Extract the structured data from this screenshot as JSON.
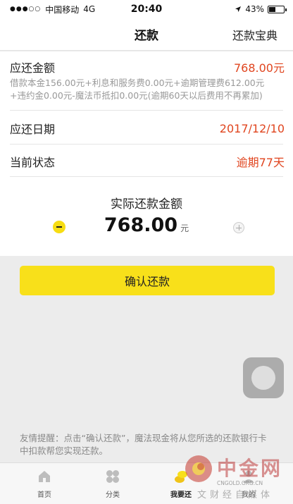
{
  "status_bar": {
    "signal": "●●●○○",
    "carrier": "中国移动",
    "network": "4G",
    "time": "20:40",
    "location_icon": "location-arrow-icon",
    "battery_percent_text": "43%",
    "battery_level": 0.43
  },
  "nav": {
    "title": "还款",
    "right_link": "还款宝典"
  },
  "repayment": {
    "amount_label": "应还金额",
    "amount_value": "768.00元",
    "detail": "借款本金156.00元+利息和服务费0.00元+逾期管理费612.00元+违约金0.00元-魔法币抵扣0.00元(逾期60天以后费用不再累加)",
    "due_date_label": "应还日期",
    "due_date_value": "2017/12/10",
    "status_label": "当前状态",
    "status_value": "逾期77天",
    "actual_label": "实际还款金额",
    "actual_amount": "768.00",
    "actual_unit": "元",
    "confirm_button": "确认还款",
    "tip": "友情提醒：点击“确认还款”，魔法现金将从您所选的还款银行卡中扣款帮您实现还款。"
  },
  "tabs": [
    {
      "label": "首页",
      "icon": "home-icon",
      "active": false
    },
    {
      "label": "分类",
      "icon": "category-icon",
      "active": false
    },
    {
      "label": "我要还",
      "icon": "coins-icon",
      "active": true
    },
    {
      "label": "我的",
      "icon": "profile-icon",
      "active": false
    }
  ],
  "watermark": {
    "brand": "中金网",
    "domain": "CNGOLD.ORG.CN",
    "subtitle": "文财经自媒体"
  },
  "colors": {
    "accent_yellow": "#f8e01a",
    "alert_red": "#e0451f",
    "background": "#ececec"
  }
}
